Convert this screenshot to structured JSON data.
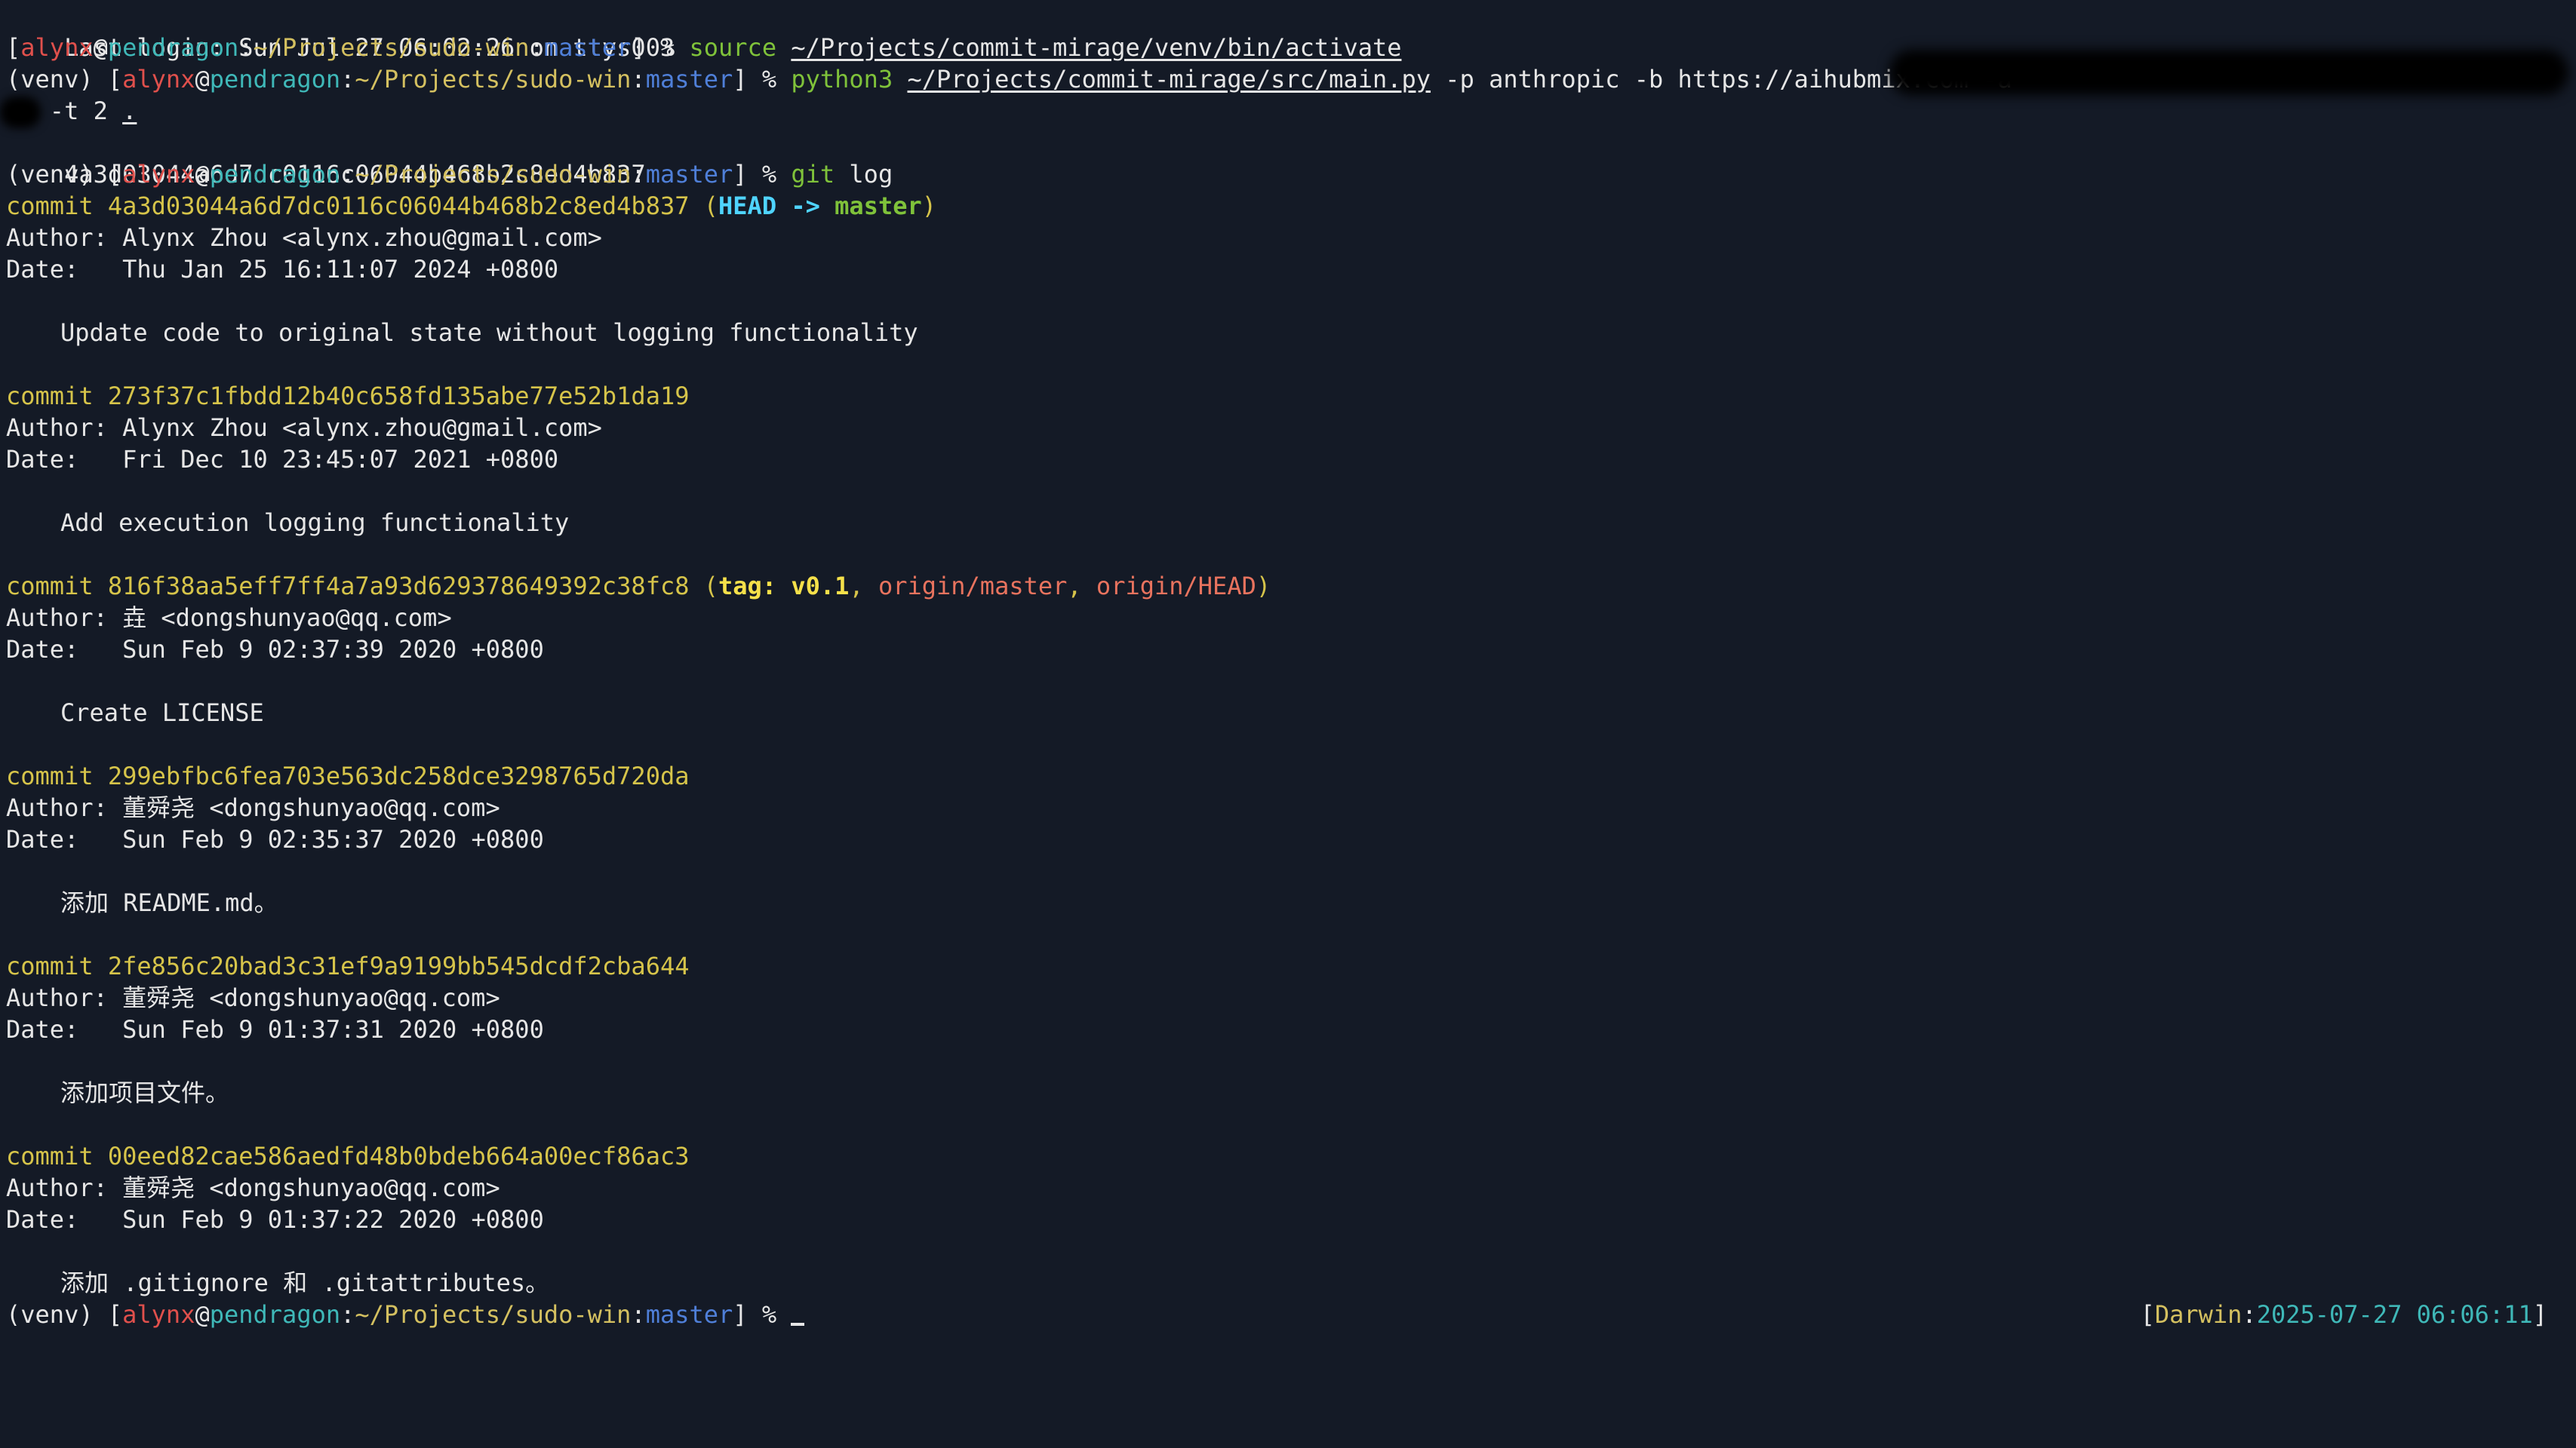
{
  "colors": {
    "background": "#141a26",
    "foreground": "#e6e6e6",
    "user": "#e0504c",
    "host": "#3fb8b8",
    "path": "#d4c060",
    "branch": "#4f7fd8",
    "command": "#7fc23a",
    "commit": "#d6c44a",
    "head_ref": "#4fd4ff",
    "tag_ref": "#f5e04a",
    "origin_ref": "#e8735e"
  },
  "terminal": {
    "last_login": "Last login: Sun Jul 27 06:02:26 on ttys003",
    "prompt": {
      "venv": "(venv) ",
      "open_bracket": "[",
      "user": "alynx",
      "at": "@",
      "host": "pendragon",
      "colon": ":",
      "path": "~/Projects/sudo-win",
      "colon2": ":",
      "branch": "master",
      "close": "] % "
    },
    "cmd1": {
      "name": "source",
      "arg": "~/Projects/commit-mirage/venv/bin/activate"
    },
    "cmd2": {
      "name": "python3",
      "script": "~/Projects/commit-mirage/src/main.py",
      "args": " -p anthropic -b https://aihubmix.com -a ",
      "args_cont": "   -t 2 ",
      "dot": "."
    },
    "output_hash": "4a3d03044a6d7dc0116c06044b468b2c8ed4b837",
    "cmd3": {
      "name": "git",
      "args": " log"
    },
    "commits": [
      {
        "hash_line": "commit 4a3d03044a6d7dc0116c06044b468b2c8ed4b837",
        "ref_open": " (",
        "head": "HEAD -> ",
        "branch": "master",
        "ref_close": ")",
        "author": "Author: Alynx Zhou <alynx.zhou@gmail.com>",
        "date": "Date:   Thu Jan 25 16:11:07 2024 +0800",
        "message": "Update code to original state without logging functionality"
      },
      {
        "hash_line": "commit 273f37c1fbdd12b40c658fd135abe77e52b1da19",
        "author": "Author: Alynx Zhou <alynx.zhou@gmail.com>",
        "date": "Date:   Fri Dec 10 23:45:07 2021 +0800",
        "message": "Add execution logging functionality"
      },
      {
        "hash_line": "commit 816f38aa5eff7ff4a7a93d629378649392c38fc8",
        "ref_open": " (",
        "tag": "tag: v0.1",
        "sep1": ", ",
        "origin_master": "origin/master",
        "sep2": ", ",
        "origin_head": "origin/HEAD",
        "ref_close": ")",
        "author": "Author: 垚 <dongshunyao@qq.com>",
        "date": "Date:   Sun Feb 9 02:37:39 2020 +0800",
        "message": "Create LICENSE"
      },
      {
        "hash_line": "commit 299ebfbc6fea703e563dc258dce3298765d720da",
        "author": "Author: 董舜尧 <dongshunyao@qq.com>",
        "date": "Date:   Sun Feb 9 02:35:37 2020 +0800",
        "message": "添加 README.md。"
      },
      {
        "hash_line": "commit 2fe856c20bad3c31ef9a9199bb545dcdf2cba644",
        "author": "Author: 董舜尧 <dongshunyao@qq.com>",
        "date": "Date:   Sun Feb 9 01:37:31 2020 +0800",
        "message": "添加项目文件。"
      },
      {
        "hash_line": "commit 00eed82cae586aedfd48b0bdeb664a00ecf86ac3",
        "author": "Author: 董舜尧 <dongshunyao@qq.com>",
        "date": "Date:   Sun Feb 9 01:37:22 2020 +0800",
        "message": "添加 .gitignore 和 .gitattributes。"
      }
    ],
    "right_prompt": {
      "open": "[",
      "os": "Darwin",
      "colon": ":",
      "datetime": "2025-07-27 06:06:11",
      "close": "]"
    }
  }
}
